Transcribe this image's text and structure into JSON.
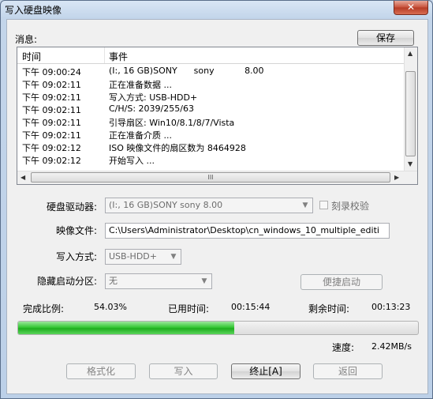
{
  "window": {
    "title": "写入硬盘映像",
    "close_glyph": "✕"
  },
  "log": {
    "label": "消息:",
    "save_button": "保存",
    "columns": [
      "时间",
      "事件"
    ],
    "rows": [
      {
        "time": "下午 09:00:24",
        "event": "(I:, 16 GB)SONY      sony           8.00"
      },
      {
        "time": "下午 09:02:11",
        "event": "正在准备数据 ..."
      },
      {
        "time": "下午 09:02:11",
        "event": "写入方式: USB-HDD+"
      },
      {
        "time": "下午 09:02:11",
        "event": "C/H/S: 2039/255/63"
      },
      {
        "time": "下午 09:02:11",
        "event": "引导扇区: Win10/8.1/8/7/Vista"
      },
      {
        "time": "下午 09:02:11",
        "event": "正在准备介质 ..."
      },
      {
        "time": "下午 09:02:12",
        "event": "ISO 映像文件的扇区数为 8464928"
      },
      {
        "time": "下午 09:02:12",
        "event": "开始写入 ..."
      }
    ],
    "hscroll_grip": "III"
  },
  "form": {
    "drive_label": "硬盘驱动器:",
    "drive_value": "(I:, 16 GB)SONY     sony          8.00",
    "verify_label": "刻录校验",
    "image_label": "映像文件:",
    "image_value": "C:\\Users\\Administrator\\Desktop\\cn_windows_10_multiple_editi",
    "method_label": "写入方式:",
    "method_value": "USB-HDD+",
    "hidden_label": "隐藏启动分区:",
    "hidden_value": "无",
    "quick_boot_button": "便捷启动"
  },
  "status": {
    "completed_label": "完成比例:",
    "completed_value": "54.03%",
    "progress_fraction": 0.5403,
    "elapsed_label": "已用时间:",
    "elapsed_value": "00:15:44",
    "remaining_label": "剩余时间:",
    "remaining_value": "00:13:23",
    "speed_label": "速度:",
    "speed_value": "2.42MB/s"
  },
  "buttons": {
    "format": "格式化",
    "write": "写入",
    "abort": "终止[A]",
    "back": "返回"
  },
  "colors": {
    "progress_green": "#1fae1f"
  }
}
